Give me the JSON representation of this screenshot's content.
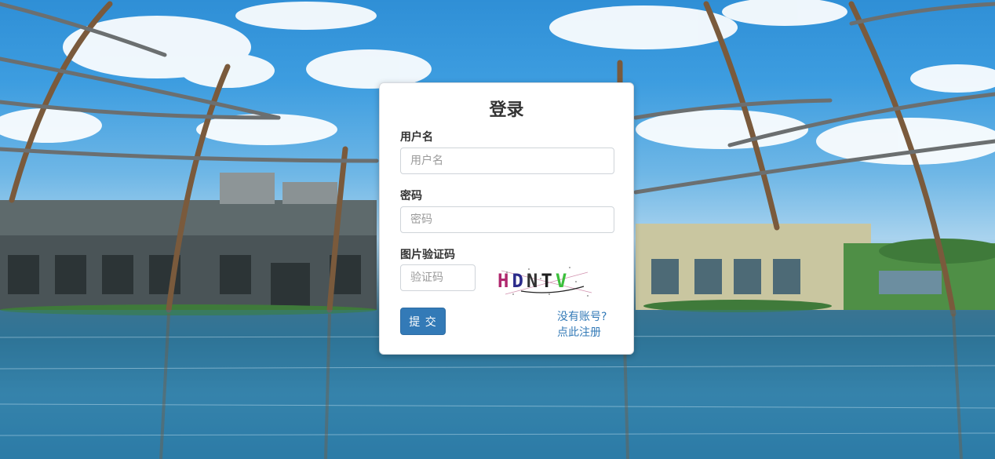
{
  "login": {
    "title": "登录",
    "username_label": "用户名",
    "username_placeholder": "用户名",
    "password_label": "密码",
    "password_placeholder": "密码",
    "captcha_label": "图片验证码",
    "captcha_placeholder": "验证码",
    "captcha_text": "HDNTV",
    "submit_label": "提 交",
    "register_line1": "没有账号?",
    "register_line2": "点此注册"
  },
  "colors": {
    "primary": "#337ab7",
    "link": "#337ab7",
    "card_bg": "#ffffff"
  }
}
